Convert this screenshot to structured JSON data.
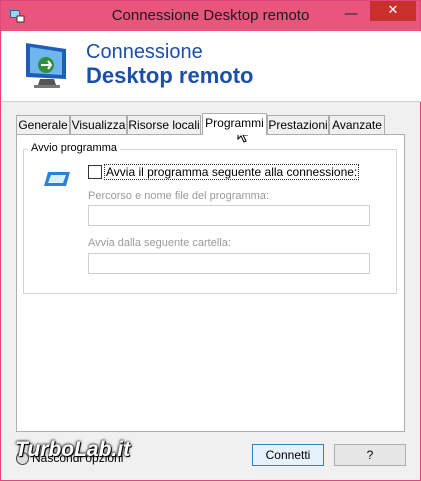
{
  "window": {
    "title": "Connessione Desktop remoto",
    "minimize_glyph": "—",
    "close_glyph": "✕"
  },
  "header": {
    "line1": "Connessione",
    "line2": "Desktop remoto"
  },
  "tabs": [
    {
      "label": "Generale"
    },
    {
      "label": "Visualizza"
    },
    {
      "label": "Risorse locali"
    },
    {
      "label": "Programmi",
      "active": true
    },
    {
      "label": "Prestazioni"
    },
    {
      "label": "Avanzate"
    }
  ],
  "program_group": {
    "legend": "Avvio programma",
    "checkbox_label": "Avvia il programma seguente alla connessione:",
    "checkbox_checked": false,
    "path_label": "Percorso e nome file del programma:",
    "path_value": "",
    "folder_label": "Avvia  dalla seguente cartella:",
    "folder_value": ""
  },
  "footer": {
    "options_label": "Nascondi opzioni",
    "connect_label": "Connetti",
    "help_label": "?"
  },
  "watermark": "TurboLab.it",
  "colors": {
    "titlebar": "#e9557d",
    "close": "#c7302b",
    "brand_blue": "#1d4fa8"
  }
}
